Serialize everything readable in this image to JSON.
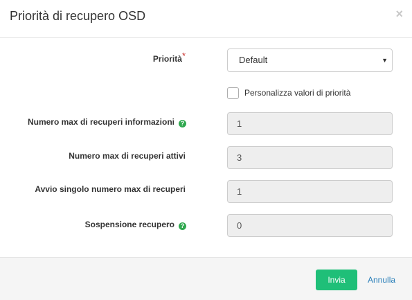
{
  "modal": {
    "title": "Priorità di recupero OSD",
    "close_label": "×"
  },
  "form": {
    "priority": {
      "label": "Priorità",
      "required_mark": "*",
      "selected": "Default"
    },
    "customize": {
      "label": "Personalizza valori di priorità",
      "checked": false
    },
    "fields": [
      {
        "label": "Numero max di recuperi informazioni",
        "value": "1",
        "help_icon": true
      },
      {
        "label": "Numero max di recuperi attivi",
        "value": "3",
        "help_icon": false
      },
      {
        "label": "Avvio singolo numero max di recuperi",
        "value": "1",
        "help_icon": false
      },
      {
        "label": "Sospensione recupero",
        "value": "0",
        "help_icon": true
      }
    ],
    "help_glyph": "?"
  },
  "footer": {
    "submit_label": "Invia",
    "cancel_label": "Annulla"
  },
  "colors": {
    "submit": "#1fbf78",
    "cancel_link": "#2a7fb9",
    "help_icon": "#2fa84f",
    "required": "#c9302c"
  }
}
